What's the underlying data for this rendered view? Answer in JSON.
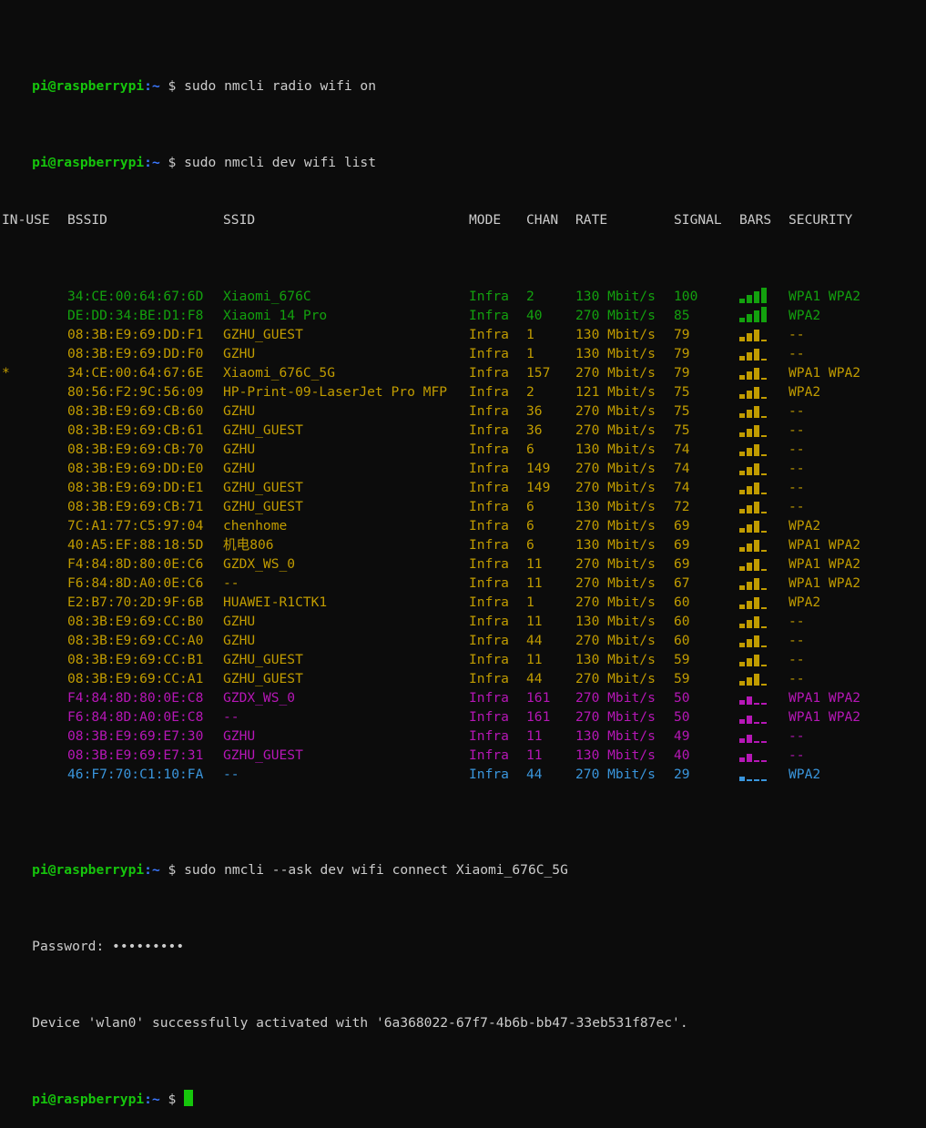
{
  "prompt": {
    "user_host": "pi@raspberrypi",
    "path": ":~",
    "dollar": "$"
  },
  "colors": {
    "green_dark": "#13a10e",
    "green_bright": "#16c60c",
    "yellow": "#c19c00",
    "magenta": "#b617b6",
    "cyan": "#3a96dd",
    "default": "#cccccc",
    "blue": "#3b78ff",
    "background": "#0c0c0c"
  },
  "commands": {
    "radio_on": "sudo nmcli radio wifi on",
    "wifi_list": "sudo nmcli dev wifi list",
    "connect": "sudo nmcli --ask dev wifi connect Xiaomi_676C_5G"
  },
  "table": {
    "headers": {
      "inuse": "IN-USE",
      "bssid": "BSSID",
      "ssid": "SSID",
      "mode": "MODE",
      "chan": "CHAN",
      "rate": "RATE",
      "signal": "SIGNAL",
      "bars": "BARS",
      "security": "SECURITY"
    },
    "rows": [
      {
        "inuse": "",
        "bssid": "34:CE:00:64:67:6D",
        "ssid": "Xiaomi_676C",
        "mode": "Infra",
        "chan": "2",
        "rate": "130 Mbit/s",
        "signal": "100",
        "bars_level": 4,
        "security": "WPA1 WPA2",
        "color": "green_dark"
      },
      {
        "inuse": "",
        "bssid": "DE:DD:34:BE:D1:F8",
        "ssid": "Xiaomi 14 Pro",
        "mode": "Infra",
        "chan": "40",
        "rate": "270 Mbit/s",
        "signal": "85",
        "bars_level": 4,
        "security": "WPA2",
        "color": "green_dark"
      },
      {
        "inuse": "",
        "bssid": "08:3B:E9:69:DD:F1",
        "ssid": "GZHU_GUEST",
        "mode": "Infra",
        "chan": "1",
        "rate": "130 Mbit/s",
        "signal": "79",
        "bars_level": 3,
        "security": "--",
        "color": "yellow"
      },
      {
        "inuse": "",
        "bssid": "08:3B:E9:69:DD:F0",
        "ssid": "GZHU",
        "mode": "Infra",
        "chan": "1",
        "rate": "130 Mbit/s",
        "signal": "79",
        "bars_level": 3,
        "security": "--",
        "color": "yellow"
      },
      {
        "inuse": "*",
        "bssid": "34:CE:00:64:67:6E",
        "ssid": "Xiaomi_676C_5G",
        "mode": "Infra",
        "chan": "157",
        "rate": "270 Mbit/s",
        "signal": "79",
        "bars_level": 3,
        "security": "WPA1 WPA2",
        "color": "yellow"
      },
      {
        "inuse": "",
        "bssid": "80:56:F2:9C:56:09",
        "ssid": "HP-Print-09-LaserJet Pro MFP",
        "mode": "Infra",
        "chan": "2",
        "rate": "121 Mbit/s",
        "signal": "75",
        "bars_level": 3,
        "security": "WPA2",
        "color": "yellow"
      },
      {
        "inuse": "",
        "bssid": "08:3B:E9:69:CB:60",
        "ssid": "GZHU",
        "mode": "Infra",
        "chan": "36",
        "rate": "270 Mbit/s",
        "signal": "75",
        "bars_level": 3,
        "security": "--",
        "color": "yellow"
      },
      {
        "inuse": "",
        "bssid": "08:3B:E9:69:CB:61",
        "ssid": "GZHU_GUEST",
        "mode": "Infra",
        "chan": "36",
        "rate": "270 Mbit/s",
        "signal": "75",
        "bars_level": 3,
        "security": "--",
        "color": "yellow"
      },
      {
        "inuse": "",
        "bssid": "08:3B:E9:69:CB:70",
        "ssid": "GZHU",
        "mode": "Infra",
        "chan": "6",
        "rate": "130 Mbit/s",
        "signal": "74",
        "bars_level": 3,
        "security": "--",
        "color": "yellow"
      },
      {
        "inuse": "",
        "bssid": "08:3B:E9:69:DD:E0",
        "ssid": "GZHU",
        "mode": "Infra",
        "chan": "149",
        "rate": "270 Mbit/s",
        "signal": "74",
        "bars_level": 3,
        "security": "--",
        "color": "yellow"
      },
      {
        "inuse": "",
        "bssid": "08:3B:E9:69:DD:E1",
        "ssid": "GZHU_GUEST",
        "mode": "Infra",
        "chan": "149",
        "rate": "270 Mbit/s",
        "signal": "74",
        "bars_level": 3,
        "security": "--",
        "color": "yellow"
      },
      {
        "inuse": "",
        "bssid": "08:3B:E9:69:CB:71",
        "ssid": "GZHU_GUEST",
        "mode": "Infra",
        "chan": "6",
        "rate": "130 Mbit/s",
        "signal": "72",
        "bars_level": 3,
        "security": "--",
        "color": "yellow"
      },
      {
        "inuse": "",
        "bssid": "7C:A1:77:C5:97:04",
        "ssid": "chenhome",
        "mode": "Infra",
        "chan": "6",
        "rate": "270 Mbit/s",
        "signal": "69",
        "bars_level": 3,
        "security": "WPA2",
        "color": "yellow"
      },
      {
        "inuse": "",
        "bssid": "40:A5:EF:88:18:5D",
        "ssid": "机电806",
        "mode": "Infra",
        "chan": "6",
        "rate": "130 Mbit/s",
        "signal": "69",
        "bars_level": 3,
        "security": "WPA1 WPA2",
        "color": "yellow"
      },
      {
        "inuse": "",
        "bssid": "F4:84:8D:80:0E:C6",
        "ssid": "GZDX_WS_0",
        "mode": "Infra",
        "chan": "11",
        "rate": "270 Mbit/s",
        "signal": "69",
        "bars_level": 3,
        "security": "WPA1 WPA2",
        "color": "yellow"
      },
      {
        "inuse": "",
        "bssid": "F6:84:8D:A0:0E:C6",
        "ssid": "--",
        "mode": "Infra",
        "chan": "11",
        "rate": "270 Mbit/s",
        "signal": "67",
        "bars_level": 3,
        "security": "WPA1 WPA2",
        "color": "yellow"
      },
      {
        "inuse": "",
        "bssid": "E2:B7:70:2D:9F:6B",
        "ssid": "HUAWEI-R1CTK1",
        "mode": "Infra",
        "chan": "1",
        "rate": "270 Mbit/s",
        "signal": "60",
        "bars_level": 3,
        "security": "WPA2",
        "color": "yellow"
      },
      {
        "inuse": "",
        "bssid": "08:3B:E9:69:CC:B0",
        "ssid": "GZHU",
        "mode": "Infra",
        "chan": "11",
        "rate": "130 Mbit/s",
        "signal": "60",
        "bars_level": 3,
        "security": "--",
        "color": "yellow"
      },
      {
        "inuse": "",
        "bssid": "08:3B:E9:69:CC:A0",
        "ssid": "GZHU",
        "mode": "Infra",
        "chan": "44",
        "rate": "270 Mbit/s",
        "signal": "60",
        "bars_level": 3,
        "security": "--",
        "color": "yellow"
      },
      {
        "inuse": "",
        "bssid": "08:3B:E9:69:CC:B1",
        "ssid": "GZHU_GUEST",
        "mode": "Infra",
        "chan": "11",
        "rate": "130 Mbit/s",
        "signal": "59",
        "bars_level": 3,
        "security": "--",
        "color": "yellow"
      },
      {
        "inuse": "",
        "bssid": "08:3B:E9:69:CC:A1",
        "ssid": "GZHU_GUEST",
        "mode": "Infra",
        "chan": "44",
        "rate": "270 Mbit/s",
        "signal": "59",
        "bars_level": 3,
        "security": "--",
        "color": "yellow"
      },
      {
        "inuse": "",
        "bssid": "F4:84:8D:80:0E:C8",
        "ssid": "GZDX_WS_0",
        "mode": "Infra",
        "chan": "161",
        "rate": "270 Mbit/s",
        "signal": "50",
        "bars_level": 2,
        "security": "WPA1 WPA2",
        "color": "magenta"
      },
      {
        "inuse": "",
        "bssid": "F6:84:8D:A0:0E:C8",
        "ssid": "--",
        "mode": "Infra",
        "chan": "161",
        "rate": "270 Mbit/s",
        "signal": "50",
        "bars_level": 2,
        "security": "WPA1 WPA2",
        "color": "magenta"
      },
      {
        "inuse": "",
        "bssid": "08:3B:E9:69:E7:30",
        "ssid": "GZHU",
        "mode": "Infra",
        "chan": "11",
        "rate": "130 Mbit/s",
        "signal": "49",
        "bars_level": 2,
        "security": "--",
        "color": "magenta"
      },
      {
        "inuse": "",
        "bssid": "08:3B:E9:69:E7:31",
        "ssid": "GZHU_GUEST",
        "mode": "Infra",
        "chan": "11",
        "rate": "130 Mbit/s",
        "signal": "40",
        "bars_level": 2,
        "security": "--",
        "color": "magenta"
      },
      {
        "inuse": "",
        "bssid": "46:F7:70:C1:10:FA",
        "ssid": "--",
        "mode": "Infra",
        "chan": "44",
        "rate": "270 Mbit/s",
        "signal": "29",
        "bars_level": 1,
        "security": "WPA2",
        "color": "cyan"
      }
    ]
  },
  "output": {
    "password_label": "Password: ",
    "password_mask": "•••••••••",
    "activated": "Device 'wlan0' successfully activated with '6a368022-67f7-4b6b-bb47-33eb531f87ec'."
  }
}
